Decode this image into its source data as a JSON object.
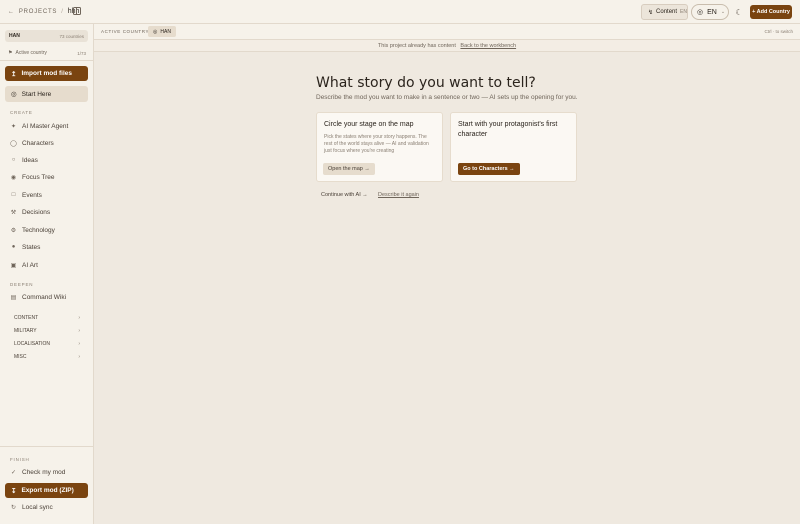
{
  "topbar": {
    "breadcrumb_root": "PROJECTS",
    "breadcrumb_sep": "/",
    "project_name": "hhh",
    "content_label": "Content",
    "content_lang": "EN",
    "language": "EN",
    "add_country": "+ Add Country"
  },
  "sidebar": {
    "country_tag": "HAN",
    "country_count": "73 countries",
    "active_label": "Active country",
    "active_ratio": "1/73",
    "import_label": "Import mod files",
    "start_label": "Start Here",
    "create_section": "CREATE",
    "create_items": [
      "AI Master Agent",
      "Characters",
      "Ideas",
      "Focus Tree",
      "Events",
      "Decisions",
      "Technology",
      "States",
      "AI Art"
    ],
    "deepen_section": "DEEPEN",
    "wiki_label": "Command Wiki",
    "groups": [
      "CONTENT",
      "MILITARY",
      "LOCALISATION",
      "MISC"
    ],
    "finish_section": "FINISH",
    "check_label": "Check my mod",
    "export_label": "Export mod (ZIP)",
    "sync_label": "Local sync"
  },
  "subbar": {
    "label": "ACTIVE COUNTRY",
    "country": "HAN",
    "meta": "Ctrl · to switch"
  },
  "notice": {
    "text": "This project already has content",
    "link": "Back to the workbench"
  },
  "main": {
    "title": "What story do you want to tell?",
    "subtitle": "Describe the mod you want to make in a sentence or two — AI sets up the opening for you.",
    "card1": {
      "title": "Circle your stage on the map",
      "body": "Pick the states where your story happens. The rest of the world stays alive — AI and validation just focus where you're creating",
      "button": "Open the map →"
    },
    "card2": {
      "title": "Start with your protagonist's first character",
      "button": "Go to Characters →"
    },
    "continue_ai": "Continue with AI →",
    "describe_again": "Describe it again"
  },
  "colors": {
    "accent": "#7a4410",
    "background": "#efe9e0",
    "sidebar": "#f6f2ea"
  }
}
